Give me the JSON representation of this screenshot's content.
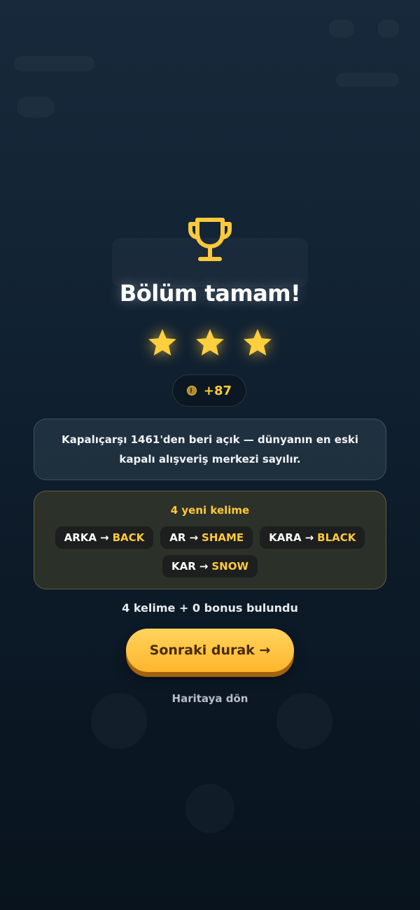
{
  "result": {
    "title": "Bölüm tamam!",
    "stars_earned": 3,
    "stars_total": 3,
    "coins_earned": "+87"
  },
  "fact": {
    "text": "Kapalıçarşı 1461'den beri açık — dünyanın en eski kapalı alışveriş merkezi sayılır."
  },
  "new_words": {
    "title": "4 yeni kelime",
    "items": [
      {
        "source": "ARKA",
        "arrow": "→",
        "target": "BACK"
      },
      {
        "source": "AR",
        "arrow": "→",
        "target": "SHAME"
      },
      {
        "source": "KARA",
        "arrow": "→",
        "target": "BLACK"
      },
      {
        "source": "KAR",
        "arrow": "→",
        "target": "SNOW"
      }
    ]
  },
  "summary": {
    "found_text": "4 kelime + 0 bonus bulundu"
  },
  "actions": {
    "next_label": "Sonraki durak →",
    "back_label": "Haritaya dön"
  },
  "colors": {
    "accent_gold": "#ffc93a",
    "button_top": "#ffd45e",
    "button_bottom": "#ffb52b",
    "background": "#122334"
  },
  "icons": [
    "trophy-icon",
    "star-icon",
    "coin-icon",
    "arrow-right-icon"
  ]
}
